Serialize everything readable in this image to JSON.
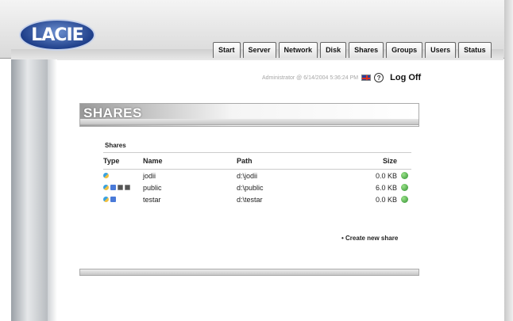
{
  "header": {
    "logo_text": "LACIE",
    "tabs": [
      {
        "label": "Start"
      },
      {
        "label": "Server"
      },
      {
        "label": "Network"
      },
      {
        "label": "Disk"
      },
      {
        "label": "Shares"
      },
      {
        "label": "Groups"
      },
      {
        "label": "Users"
      },
      {
        "label": "Status"
      }
    ]
  },
  "userbar": {
    "user_text": "Administrator @ 6/14/2004 5:36:24 PM",
    "help_glyph": "?",
    "logoff_label": "Log Off"
  },
  "page": {
    "title": "SHARES",
    "section_label": "Shares",
    "columns": {
      "type": "Type",
      "name": "Name",
      "path": "Path",
      "size": "Size"
    },
    "rows": [
      {
        "name": "jodii",
        "path": "d:\\jodii",
        "size": "0.0 KB"
      },
      {
        "name": "public",
        "path": "d:\\public",
        "size": "6.0 KB"
      },
      {
        "name": "testar",
        "path": "d:\\testar",
        "size": "0.0 KB"
      }
    ],
    "create_link": "• Create new share"
  }
}
